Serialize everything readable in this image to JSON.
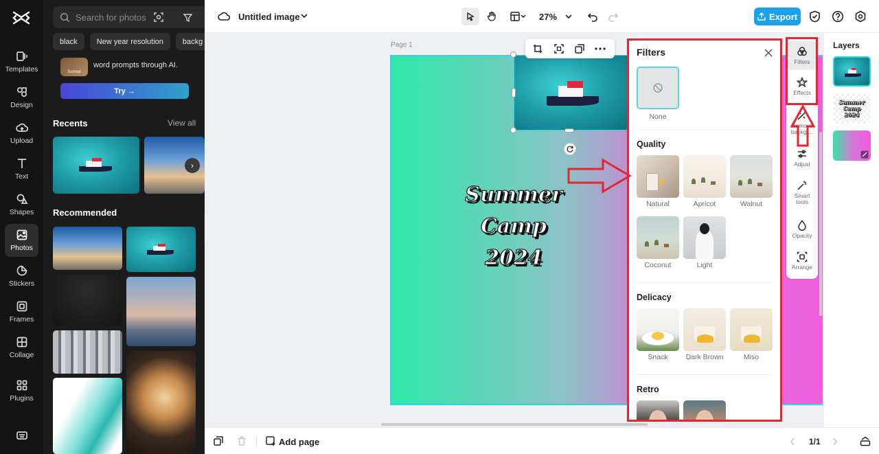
{
  "rail": {
    "items": [
      {
        "label": "Templates"
      },
      {
        "label": "Design"
      },
      {
        "label": "Upload"
      },
      {
        "label": "Text"
      },
      {
        "label": "Shapes"
      },
      {
        "label": "Photos"
      },
      {
        "label": "Stickers"
      },
      {
        "label": "Frames"
      },
      {
        "label": "Collage"
      },
      {
        "label": "Plugins"
      }
    ]
  },
  "photos_panel": {
    "search_placeholder": "Search for photos",
    "chips": [
      "black",
      "New year resolution",
      "backg"
    ],
    "promo_badge": "Surreal",
    "promo_text": "word prompts through AI.",
    "try_label": "Try →",
    "recents_title": "Recents",
    "view_all": "View all",
    "recommended_title": "Recommended"
  },
  "topbar": {
    "title": "Untitled image",
    "zoom": "27%",
    "export_label": "Export"
  },
  "canvas": {
    "page_label": "Page 1",
    "headline_lines": [
      "Summer",
      "Camp",
      "2024"
    ]
  },
  "bottombar": {
    "add_page": "Add page",
    "page_count": "1/1"
  },
  "filters": {
    "title": "Filters",
    "none_label": "None",
    "sections": [
      {
        "title": "Quality",
        "items": [
          "Natural",
          "Apricot",
          "Walnut",
          "Coconut",
          "Light"
        ]
      },
      {
        "title": "Delicacy",
        "items": [
          "Snack",
          "Dark Brown",
          "Miso"
        ]
      },
      {
        "title": "Retro",
        "items": []
      }
    ]
  },
  "tools": {
    "filters": "Filters",
    "effects": "Effects",
    "remove_bg": "Remove backgr...",
    "adjust": "Adjust",
    "smart_tools_1": "Smart",
    "smart_tools_2": "tools",
    "opacity": "Opacity",
    "arrange": "Arrange"
  },
  "layers": {
    "title": "Layers",
    "text_layer_lines": [
      "Summer",
      "Camp",
      "2024"
    ]
  },
  "colors": {
    "accent": "#1aa1ed",
    "selection": "#2ed6e4",
    "annotation": "#e3262f"
  }
}
